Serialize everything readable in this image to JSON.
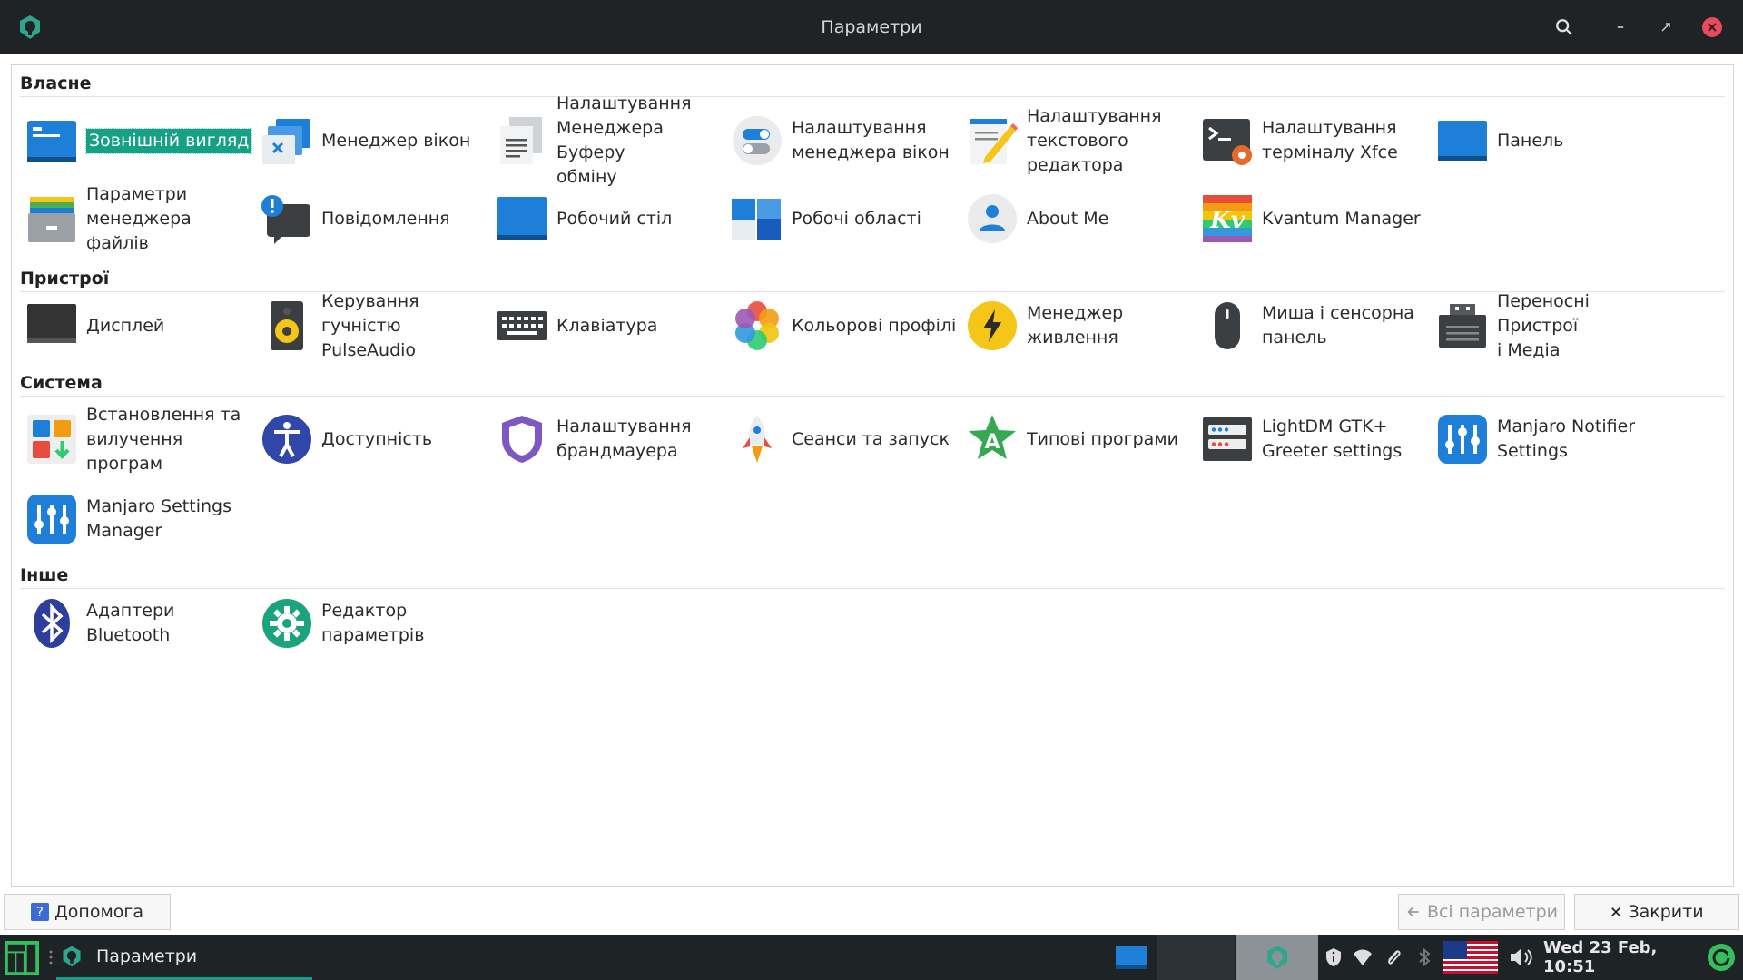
{
  "window": {
    "title": "Параметри",
    "icons": {
      "app": "manjaro-settings-icon",
      "search": "search-icon",
      "minimize": "minimize-icon",
      "maximize": "maximize-icon",
      "close": "close-icon"
    }
  },
  "sections": [
    {
      "title": "Власне",
      "items": [
        {
          "label": "Зовнішній вигляд",
          "icon": "appearance-icon",
          "selected": true
        },
        {
          "label": "Менеджер вікон",
          "icon": "window-manager-icon"
        },
        {
          "label": "Налаштування\nМенеджера Буферу\nобміну",
          "icon": "clipboard-icon"
        },
        {
          "label": "Налаштування\nменеджера вікон",
          "icon": "window-tweaks-icon"
        },
        {
          "label": "Налаштування\nтекстового\nредактора",
          "icon": "text-editor-icon"
        },
        {
          "label": "Налаштування\nтерміналу Xfce",
          "icon": "terminal-icon"
        },
        {
          "label": "Панель",
          "icon": "panel-icon"
        },
        {
          "label": "Параметри\nменеджера файлів",
          "icon": "file-manager-icon"
        },
        {
          "label": "Повідомлення",
          "icon": "notifications-icon"
        },
        {
          "label": "Робочий стіл",
          "icon": "desktop-icon"
        },
        {
          "label": "Робочі області",
          "icon": "workspaces-icon"
        },
        {
          "label": "About Me",
          "icon": "user-icon"
        },
        {
          "label": "Kvantum Manager",
          "icon": "kvantum-icon"
        }
      ]
    },
    {
      "title": "Пристрої",
      "items": [
        {
          "label": "Дисплей",
          "icon": "display-icon"
        },
        {
          "label": "Керування гучністю\nPulseAudio",
          "icon": "speaker-icon"
        },
        {
          "label": "Клавіатура",
          "icon": "keyboard-icon"
        },
        {
          "label": "Кольорові профілі",
          "icon": "color-profiles-icon"
        },
        {
          "label": "Менеджер\nживлення",
          "icon": "power-icon"
        },
        {
          "label": "Миша і сенсорна\nпанель",
          "icon": "mouse-icon"
        },
        {
          "label": "Переносні Пристрої\nі Медіа",
          "icon": "removable-media-icon"
        }
      ]
    },
    {
      "title": "Система",
      "items": [
        {
          "label": "Встановлення та\nвилучення\nпрограм",
          "icon": "software-icon"
        },
        {
          "label": "Доступність",
          "icon": "accessibility-icon"
        },
        {
          "label": "Налаштування\nбрандмауера",
          "icon": "firewall-icon"
        },
        {
          "label": "Сеанси та запуск",
          "icon": "session-icon"
        },
        {
          "label": "Типові програми",
          "icon": "default-apps-icon"
        },
        {
          "label": "LightDM GTK+\nGreeter settings",
          "icon": "lightdm-icon"
        },
        {
          "label": "Manjaro Notifier\nSettings",
          "icon": "notifier-icon"
        },
        {
          "label": "Manjaro Settings\nManager",
          "icon": "settings-manager-icon"
        }
      ]
    },
    {
      "title": "Інше",
      "items": [
        {
          "label": "Адаптери Bluetooth",
          "icon": "bluetooth-icon"
        },
        {
          "label": "Редактор\nпараметрів",
          "icon": "settings-editor-icon"
        }
      ]
    }
  ],
  "footer": {
    "help_label": "Допомога",
    "help_icon_text": "?",
    "all_settings_label": "Всі параметри",
    "close_label": "Закрити"
  },
  "taskbar": {
    "task_label": "Параметри",
    "clock": "Wed 23 Feb, 10:51"
  }
}
